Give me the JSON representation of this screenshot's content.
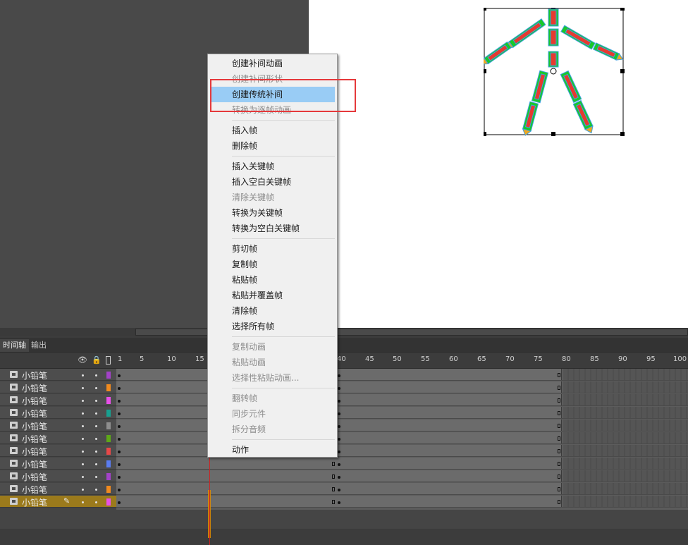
{
  "timeline_panel": {
    "tabs": [
      "时间轴",
      "输出"
    ],
    "ruler_labels": [
      "1",
      "5",
      "10",
      "15",
      "40",
      "45",
      "50",
      "55",
      "60",
      "65",
      "70",
      "75",
      "80",
      "85",
      "90",
      "95",
      "100"
    ],
    "layers": [
      {
        "name": "小铅笔",
        "color": "#a342c8"
      },
      {
        "name": "小铅笔",
        "color": "#f08a1e"
      },
      {
        "name": "小铅笔",
        "color": "#e850e8"
      },
      {
        "name": "小铅笔",
        "color": "#17a090"
      },
      {
        "name": "小铅笔",
        "color": "#8e8e8e"
      },
      {
        "name": "小铅笔",
        "color": "#5ea817"
      },
      {
        "name": "小铅笔",
        "color": "#e84848"
      },
      {
        "name": "小铅笔",
        "color": "#5a7cf0"
      },
      {
        "name": "小铅笔",
        "color": "#a342c8"
      },
      {
        "name": "小铅笔",
        "color": "#f08a1e"
      },
      {
        "name": "小铅笔",
        "color": "#e850e8",
        "selected": true
      }
    ]
  },
  "context_menu": {
    "items": [
      {
        "label": "创建补间动画",
        "disabled": false
      },
      {
        "label": "创建补间形状",
        "disabled": true
      },
      {
        "label": "创建传统补间",
        "disabled": false,
        "highlighted": true
      },
      {
        "label": "转换为逐帧动画",
        "disabled": true
      },
      {
        "label": "插入帧",
        "disabled": false
      },
      {
        "label": "删除帧",
        "disabled": false
      },
      {
        "label": "插入关键帧",
        "disabled": false
      },
      {
        "label": "插入空白关键帧",
        "disabled": false
      },
      {
        "label": "清除关键帧",
        "disabled": true
      },
      {
        "label": "转换为关键帧",
        "disabled": false
      },
      {
        "label": "转换为空白关键帧",
        "disabled": false
      },
      {
        "label": "剪切帧",
        "disabled": false
      },
      {
        "label": "复制帧",
        "disabled": false
      },
      {
        "label": "粘贴帧",
        "disabled": false
      },
      {
        "label": "粘贴并覆盖帧",
        "disabled": false
      },
      {
        "label": "清除帧",
        "disabled": false
      },
      {
        "label": "选择所有帧",
        "disabled": false
      },
      {
        "label": "复制动画",
        "disabled": true
      },
      {
        "label": "粘贴动画",
        "disabled": true
      },
      {
        "label": "选择性粘贴动画...",
        "disabled": true
      },
      {
        "label": "翻转帧",
        "disabled": true
      },
      {
        "label": "同步元件",
        "disabled": true
      },
      {
        "label": "拆分音频",
        "disabled": true
      },
      {
        "label": "动作",
        "disabled": false
      }
    ]
  },
  "colors": {
    "highlight": "#99ccf5",
    "annotation_box": "#e5393b",
    "selected_layer": "#9b7a1c"
  }
}
